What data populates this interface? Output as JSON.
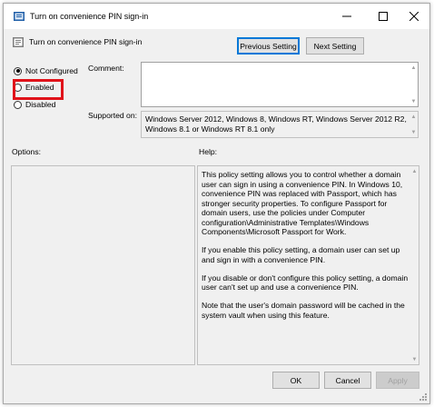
{
  "window": {
    "title": "Turn on convenience PIN sign-in",
    "colors": {
      "accent": "#0078d7",
      "highlight": "#e0131a"
    }
  },
  "header": {
    "policy_name": "Turn on convenience PIN sign-in",
    "prev_button": "Previous Setting",
    "next_button": "Next Setting"
  },
  "state": {
    "not_configured": "Not Configured",
    "enabled": "Enabled",
    "disabled": "Disabled",
    "selected": "not_configured"
  },
  "comment": {
    "label": "Comment:",
    "value": ""
  },
  "supported": {
    "label": "Supported on:",
    "value": "Windows Server 2012, Windows 8, Windows RT, Windows Server 2012 R2, Windows 8.1 or Windows RT 8.1 only"
  },
  "options": {
    "label": "Options:"
  },
  "help": {
    "label": "Help:",
    "paragraphs": [
      "This policy setting allows you to control whether a domain user can sign in using a convenience PIN. In Windows 10, convenience PIN was replaced with Passport, which has stronger security properties. To configure Passport for domain users, use the policies under Computer configuration\\Administrative Templates\\Windows Components\\Microsoft Passport for Work.",
      "If you enable this policy setting, a domain user can set up and sign in with a convenience PIN.",
      "If you disable or don't configure this policy setting, a domain user can't set up and use a convenience PIN.",
      "Note that the user's domain password will be cached in the system vault when using this feature."
    ]
  },
  "footer": {
    "ok": "OK",
    "cancel": "Cancel",
    "apply": "Apply"
  }
}
